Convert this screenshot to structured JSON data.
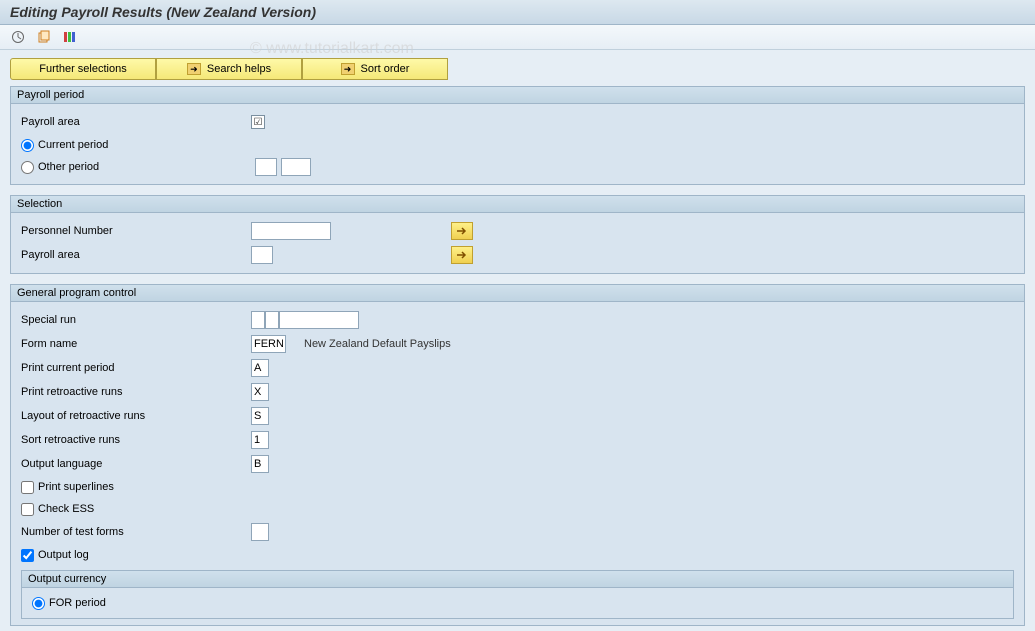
{
  "title": "Editing Payroll Results (New Zealand Version)",
  "watermark": "© www.tutorialkart.com",
  "paramButtons": {
    "further": "Further selections",
    "search": "Search helps",
    "sort": "Sort order"
  },
  "groups": {
    "payrollPeriod": {
      "title": "Payroll period",
      "payrollArea": "Payroll area",
      "currentPeriod": "Current period",
      "otherPeriod": "Other period"
    },
    "selection": {
      "title": "Selection",
      "personnelNumber": "Personnel Number",
      "payrollArea": "Payroll area"
    },
    "general": {
      "title": "General program control",
      "specialRun": "Special run",
      "formName": "Form name",
      "formNameVal": "FERN",
      "formDesc": "New Zealand Default Payslips",
      "printCurrent": "Print current period",
      "printCurrentVal": "A",
      "printRetro": "Print retroactive runs",
      "printRetroVal": "X",
      "layoutRetro": "Layout of retroactive runs",
      "layoutRetroVal": "S",
      "sortRetro": "Sort retroactive runs",
      "sortRetroVal": "1",
      "outputLang": "Output language",
      "outputLangVal": "B",
      "printSuper": "Print superlines",
      "checkEss": "Check ESS",
      "numTest": "Number of test forms",
      "outputLog": "Output log",
      "outputCurrency": {
        "title": "Output currency",
        "forPeriod": "FOR period"
      }
    }
  }
}
